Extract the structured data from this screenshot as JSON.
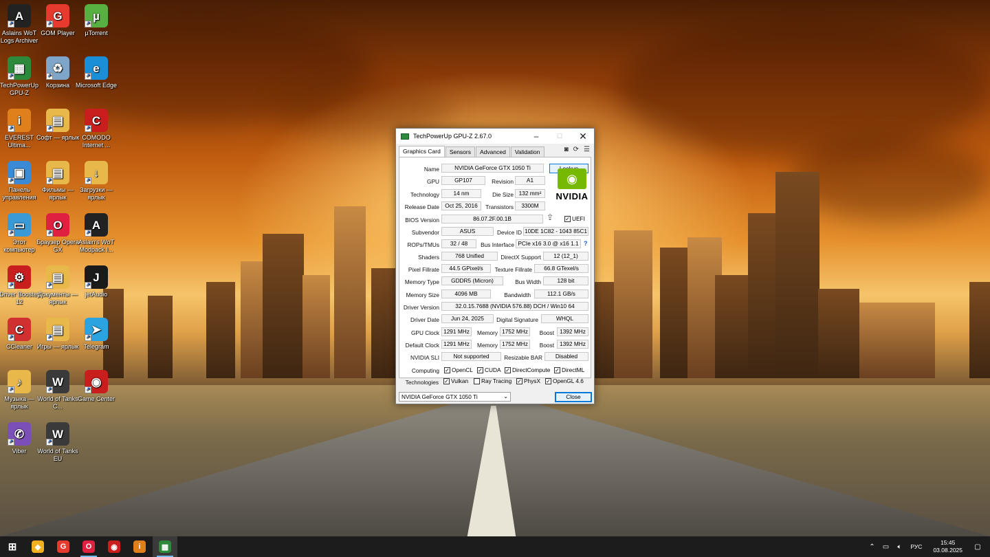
{
  "desktop": {
    "icons": [
      {
        "id": "aslains",
        "label": "Aslains WoT Logs Archiver",
        "glyph": "A",
        "color": "#222222"
      },
      {
        "id": "gom",
        "label": "GOM Player",
        "glyph": "G",
        "color": "#e63a2e"
      },
      {
        "id": "utorrent",
        "label": "µTorrent",
        "glyph": "µ",
        "color": "#58b043"
      },
      {
        "id": "gpuz",
        "label": "TechPowerUp GPU-Z",
        "glyph": "▦",
        "color": "#2d8a3c"
      },
      {
        "id": "recycle",
        "label": "Корзина",
        "glyph": "♻",
        "color": "#7fa6c8"
      },
      {
        "id": "edge",
        "label": "Microsoft Edge",
        "glyph": "e",
        "color": "#1a8fd8"
      },
      {
        "id": "everest",
        "label": "EVEREST Ultima...",
        "glyph": "i",
        "color": "#e0801c"
      },
      {
        "id": "soft",
        "label": "Софт — ярлык",
        "glyph": "▤",
        "color": "#e8b84a"
      },
      {
        "id": "comodo",
        "label": "COMODO Internet ...",
        "glyph": "C",
        "color": "#c81e1e"
      },
      {
        "id": "control",
        "label": "Панель управления",
        "glyph": "▣",
        "color": "#3a8ad6"
      },
      {
        "id": "films",
        "label": "Фильмы — ярлык",
        "glyph": "▤",
        "color": "#e8b84a"
      },
      {
        "id": "downloads",
        "label": "Загрузки — ярлык",
        "glyph": "↓",
        "color": "#e8b84a"
      },
      {
        "id": "thispc",
        "label": "Этот компьютер",
        "glyph": "▭",
        "color": "#3a9ad6"
      },
      {
        "id": "opera",
        "label": "Браузер Opera GX",
        "glyph": "O",
        "color": "#e02040"
      },
      {
        "id": "aslains2",
        "label": "Aslain's WoT Modpack I...",
        "glyph": "A",
        "color": "#222222"
      },
      {
        "id": "driver",
        "label": "Driver Booster 12",
        "glyph": "⚙",
        "color": "#c81e1e"
      },
      {
        "id": "docs",
        "label": "Документы — ярлык",
        "glyph": "▤",
        "color": "#e8b84a"
      },
      {
        "id": "jetaudio",
        "label": "jetAudio",
        "glyph": "J",
        "color": "#1a1a1a"
      },
      {
        "id": "ccleaner",
        "label": "CCleaner",
        "glyph": "C",
        "color": "#d03030"
      },
      {
        "id": "games",
        "label": "Игры — ярлык",
        "glyph": "▤",
        "color": "#e8b84a"
      },
      {
        "id": "telegram",
        "label": "Telegram",
        "glyph": "➤",
        "color": "#2aa3e0"
      },
      {
        "id": "music",
        "label": "Музыка — ярлык",
        "glyph": "♪",
        "color": "#e8b84a"
      },
      {
        "id": "wot",
        "label": "World of Tanks C...",
        "glyph": "W",
        "color": "#3a3a3a"
      },
      {
        "id": "gamecenter",
        "label": "Game Center",
        "glyph": "◉",
        "color": "#c81e1e"
      },
      {
        "id": "viber",
        "label": "Viber",
        "glyph": "✆",
        "color": "#7b4fb8"
      },
      {
        "id": "woteu",
        "label": "World of Tanks EU",
        "glyph": "W",
        "color": "#3a3a3a"
      }
    ]
  },
  "window": {
    "title": "TechPowerUp GPU-Z 2.67.0",
    "tabs": [
      "Graphics Card",
      "Sensors",
      "Advanced",
      "Validation"
    ],
    "labels": {
      "name": "Name",
      "gpu": "GPU",
      "revision": "Revision",
      "technology": "Technology",
      "die_size": "Die Size",
      "release_date": "Release Date",
      "transistors": "Transistors",
      "bios_version": "BIOS Version",
      "subvendor": "Subvendor",
      "device_id": "Device ID",
      "rops_tmus": "ROPs/TMUs",
      "bus_interface": "Bus Interface",
      "shaders": "Shaders",
      "directx": "DirectX Support",
      "pixel_fillrate": "Pixel Fillrate",
      "texture_fillrate": "Texture Fillrate",
      "memory_type": "Memory Type",
      "bus_width": "Bus Width",
      "memory_size": "Memory Size",
      "bandwidth": "Bandwidth",
      "driver_version": "Driver Version",
      "driver_date": "Driver Date",
      "digital_signature": "Digital Signature",
      "gpu_clock": "GPU Clock",
      "memory": "Memory",
      "boost": "Boost",
      "default_clock": "Default Clock",
      "nvidia_sli": "NVIDIA SLI",
      "resizable_bar": "Resizable BAR",
      "computing": "Computing",
      "technologies": "Technologies"
    },
    "values": {
      "name": "NVIDIA GeForce GTX 1050 Ti",
      "gpu": "GP107",
      "revision": "A1",
      "technology": "14 nm",
      "die_size": "132 mm²",
      "release_date": "Oct 25, 2016",
      "transistors": "3300M",
      "bios_version": "86.07.2F.00.1B",
      "subvendor": "ASUS",
      "device_id": "10DE 1C82 - 1043 85C1",
      "rops_tmus": "32 / 48",
      "bus_interface": "PCIe x16 3.0 @ x16 1.1",
      "shaders": "768 Unified",
      "directx": "12 (12_1)",
      "pixel_fillrate": "44.5 GPixel/s",
      "texture_fillrate": "66.8 GTexel/s",
      "memory_type": "GDDR5 (Micron)",
      "bus_width": "128 bit",
      "memory_size": "4096 MB",
      "bandwidth": "112.1 GB/s",
      "driver_version": "32.0.15.7688 (NVIDIA 576.88) DCH / Win10 64",
      "driver_date": "Jun 24, 2025",
      "digital_signature": "WHQL",
      "gpu_clock": "1291 MHz",
      "gpu_memory": "1752 MHz",
      "gpu_boost": "1392 MHz",
      "default_clock": "1291 MHz",
      "default_memory": "1752 MHz",
      "default_boost": "1392 MHz",
      "nvidia_sli": "Not supported",
      "resizable_bar": "Disabled"
    },
    "lookup_label": "Lookup",
    "uefi_label": "UEFI",
    "help_mark": "?",
    "logo_text": "NVIDIA",
    "computing": [
      "OpenCL",
      "CUDA",
      "DirectCompute",
      "DirectML"
    ],
    "technologies": [
      "Vulkan",
      "Ray Tracing",
      "PhysX",
      "OpenGL 4.6"
    ],
    "technologies_checked": [
      true,
      false,
      true,
      true
    ],
    "selected_gpu": "NVIDIA GeForce GTX 1050 Ti",
    "close_label": "Close"
  },
  "taskbar": {
    "apps": [
      {
        "id": "start",
        "glyph": "⊞",
        "color": "#1c1c1c"
      },
      {
        "id": "app1",
        "glyph": "◆",
        "color": "#f2b01e"
      },
      {
        "id": "gom",
        "glyph": "G",
        "color": "#e63a2e"
      },
      {
        "id": "opera",
        "glyph": "O",
        "color": "#e02040"
      },
      {
        "id": "gamecenter",
        "glyph": "◉",
        "color": "#c81e1e"
      },
      {
        "id": "everest",
        "glyph": "i",
        "color": "#e0801c"
      },
      {
        "id": "gpuz",
        "glyph": "▦",
        "color": "#2d8a3c"
      }
    ],
    "lang": "РУС",
    "time": "15:45",
    "date": "03.08.2025"
  }
}
